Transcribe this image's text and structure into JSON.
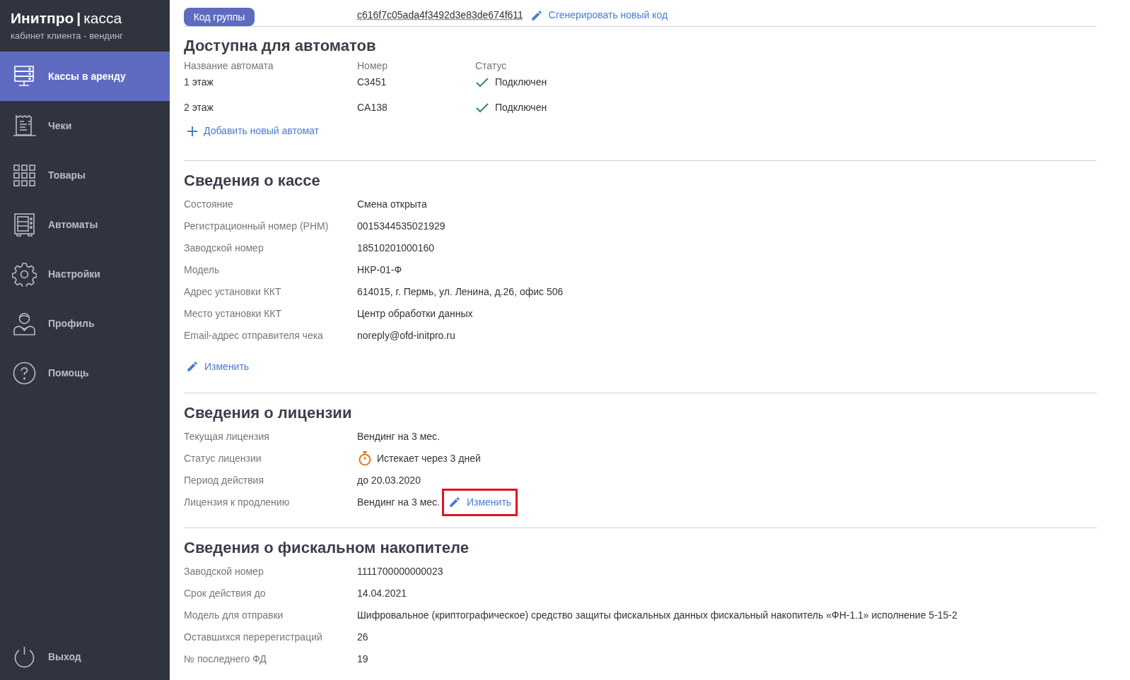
{
  "sidebar": {
    "logo_bold": "Инитпро",
    "logo_separator": "|",
    "logo_light": "касса",
    "subtitle": "кабинет клиента - вендинг",
    "items": [
      {
        "label": "Кассы в аренду",
        "selected": true
      },
      {
        "label": "Чеки",
        "selected": false
      },
      {
        "label": "Товары",
        "selected": false
      },
      {
        "label": "Автоматы",
        "selected": false
      },
      {
        "label": "Настройки",
        "selected": false
      },
      {
        "label": "Профиль",
        "selected": false
      },
      {
        "label": "Помощь",
        "selected": false
      }
    ],
    "logout": {
      "label": "Выход"
    }
  },
  "group_code": {
    "badge": "Код группы",
    "code": "c616f7c05ada4f3492d3e83de674f611",
    "action": "Сгенерировать новый код"
  },
  "machines": {
    "title": "Доступна для автоматов",
    "columns": [
      "Название автомата",
      "Номер",
      "Статус"
    ],
    "rows": [
      {
        "name": "1 этаж",
        "number": "C3451",
        "status": "Подключен",
        "connected": true
      },
      {
        "name": "2 этаж",
        "number": "CA138",
        "status": "Подключен",
        "connected": true
      }
    ],
    "add": "Добавить новый автомат"
  },
  "sections": [
    {
      "title": "Сведения о кассе",
      "fields": [
        {
          "kind": "text",
          "label": "Состояние",
          "value": "Смена открыта"
        },
        {
          "kind": "text",
          "label": "Регистрационный номер (РНМ)",
          "value": "0015344535021929"
        },
        {
          "kind": "text",
          "label": "Заводской номер",
          "value": "18510201000160"
        },
        {
          "kind": "text",
          "label": "Модель",
          "value": "НКР-01-Ф"
        },
        {
          "kind": "text",
          "label": "Адрес установки ККТ",
          "value": "614015, г. Пермь, ул. Ленина, д.26, офис 506"
        },
        {
          "kind": "text",
          "label": "Место установки ККТ",
          "value": "Центр обработки данных"
        },
        {
          "kind": "text",
          "label": "Email-адрес отправителя чека",
          "value": "noreply@ofd-initpro.ru"
        }
      ],
      "edit": "Изменить"
    },
    {
      "title": "Сведения о лицензии",
      "fields": [
        {
          "kind": "text",
          "label": "Текущая лицензия",
          "value": "Вендинг на 3 мес."
        },
        {
          "kind": "timer",
          "label": "Статус лицензии",
          "value": "Истекает через 3 дней"
        },
        {
          "kind": "text",
          "label": "Период действия",
          "value": "до 20.03.2020"
        },
        {
          "kind": "editable",
          "label": "Лицензия к продлению",
          "value": "Вендинг на 3 мес.",
          "action": "Изменить",
          "highlighted": true
        }
      ]
    },
    {
      "title": "Сведения о фискальном накопителе",
      "fields": [
        {
          "kind": "text",
          "label": "Заводской номер",
          "value": "1111700000000023"
        },
        {
          "kind": "text",
          "label": "Срок действия до",
          "value": "14.04.2021"
        },
        {
          "kind": "text",
          "label": "Модель для отправки",
          "value": "Шифровальное (криптографическое) средство защиты фискальных данных фискальный накопитель «ФН-1.1» исполнение 5-15-2"
        },
        {
          "kind": "text",
          "label": "Оставшихся перерегистраций",
          "value": "26"
        },
        {
          "kind": "text",
          "label": "№ последнего ФД",
          "value": "19"
        }
      ]
    }
  ]
}
